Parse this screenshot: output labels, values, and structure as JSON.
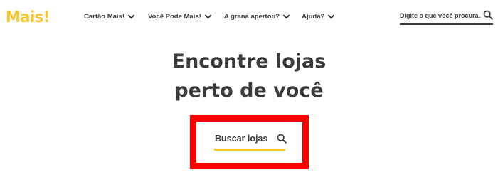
{
  "brand": {
    "logo_text": "Mais!",
    "color": "#f5c52b"
  },
  "nav": {
    "items": [
      {
        "label": "Cartão Mais!",
        "icon": "chevron-down-icon"
      },
      {
        "label": "Você Pode Mais!",
        "icon": "chevron-down-icon"
      },
      {
        "label": "A grana apertou?",
        "icon": "chevron-down-icon"
      },
      {
        "label": "Ajuda?",
        "icon": "chevron-down-icon"
      }
    ]
  },
  "search": {
    "placeholder": "Digite o que você procura...",
    "icon": "search-icon"
  },
  "hero": {
    "line1": "Encontre lojas",
    "line2": "perto de você"
  },
  "find_stores": {
    "label": "Buscar lojas",
    "icon": "search-icon",
    "accent": "#f5c52b"
  },
  "highlight": {
    "color": "#ff0000"
  }
}
